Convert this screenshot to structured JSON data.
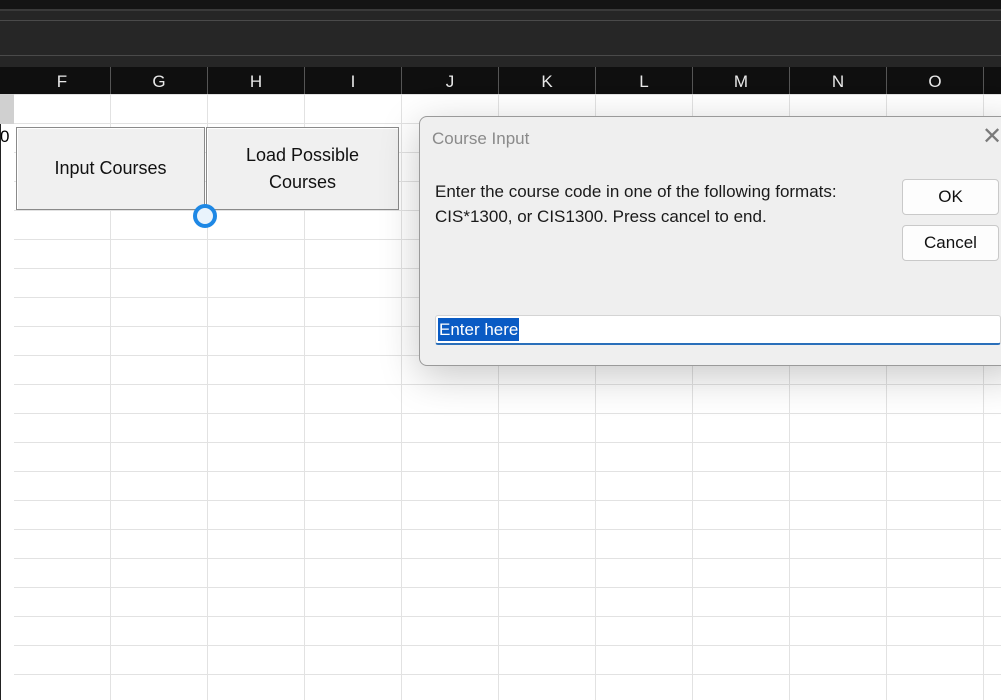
{
  "columns": [
    "F",
    "G",
    "H",
    "I",
    "J",
    "K",
    "L",
    "M",
    "N",
    "O"
  ],
  "row_fragment": "0",
  "sheet_buttons": {
    "input_courses": "Input Courses",
    "load_possible_courses": "Load Possible\nCourses"
  },
  "dialog": {
    "title": "Course Input",
    "close_icon": "close-icon",
    "message_line1": "Enter the course code in one of the following formats:",
    "message_line2": "CIS*1300, or CIS1300. Press cancel to end.",
    "ok_label": "OK",
    "cancel_label": "Cancel",
    "input_value": "Enter here"
  },
  "busy_indicator": "loading-ring-icon",
  "colors": {
    "accent": "#1e88e5",
    "selection": "#0a5bc4",
    "header_bg": "#0f0f0f"
  }
}
